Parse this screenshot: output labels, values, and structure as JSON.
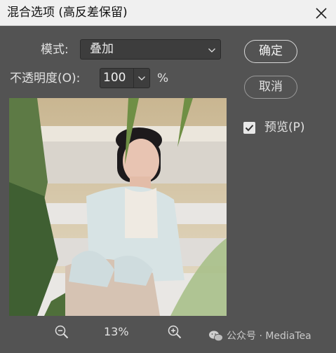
{
  "window": {
    "title": "混合选项 (高反差保留)"
  },
  "mode": {
    "label": "模式:",
    "value": "叠加"
  },
  "opacity": {
    "label": "不透明度(O):",
    "value": "100",
    "unit": "%"
  },
  "buttons": {
    "ok": "确定",
    "cancel": "取消"
  },
  "preview": {
    "label": "预览(P)",
    "checked": true
  },
  "zoom": {
    "level": "13%"
  },
  "watermark": {
    "text": "公众号 · MediaTea"
  },
  "colors": {
    "dialog_bg": "#535353",
    "titlebar_bg": "#f0f0f0",
    "field_bg": "#3d3d3d"
  },
  "icons": [
    "close-icon",
    "chevron-down-icon",
    "checkbox-checked-icon",
    "zoom-out-icon",
    "zoom-in-icon",
    "wechat-icon"
  ]
}
